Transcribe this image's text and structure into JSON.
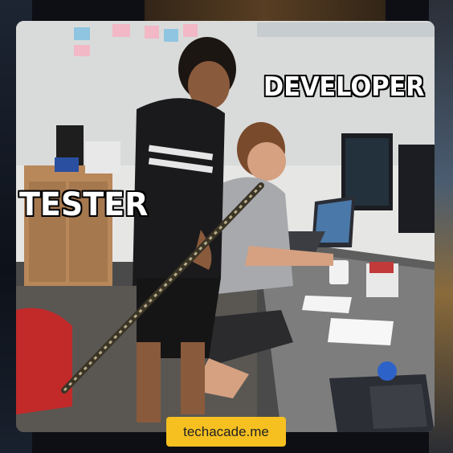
{
  "captions": {
    "developer": "DEVELOPER",
    "tester": "TESTER"
  },
  "watermark": {
    "text": "techacade.me",
    "color": "#f6c021"
  }
}
